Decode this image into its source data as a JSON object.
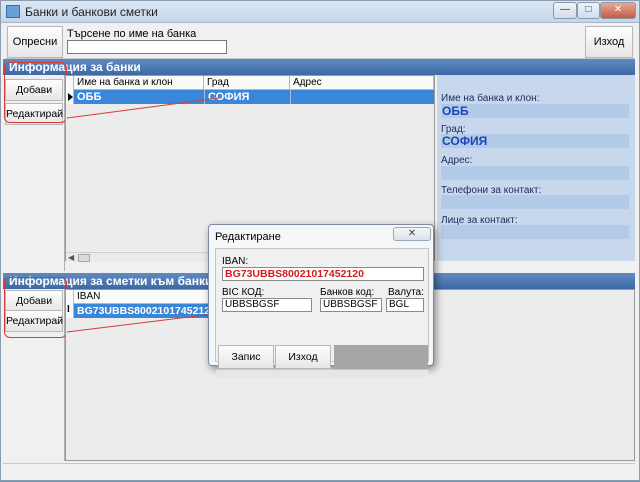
{
  "window": {
    "title": "Банки и банкови сметки"
  },
  "toolbar": {
    "refresh_label": "Опресни",
    "search_label": "Търсене по име на банка",
    "search_value": "",
    "exit_label": "Изход"
  },
  "banks_section": {
    "header": "Информация за банки",
    "add_label": "Добави",
    "edit_label": "Редактирай",
    "columns": [
      "Име на банка и клон",
      "Град",
      "Адрес"
    ],
    "row": {
      "name": "ОББ",
      "city": "СОФИЯ",
      "address": ""
    }
  },
  "bank_details": {
    "name_label": "Име на банка и клон:",
    "name_value": "ОББ",
    "city_label": "Град:",
    "city_value": "СОФИЯ",
    "address_label": "Адрес:",
    "address_value": "",
    "phones_label": "Телефони за контакт:",
    "phones_value": "",
    "contact_label": "Лице за контакт:",
    "contact_value": ""
  },
  "accounts_section": {
    "header": "Информация за сметки към банки",
    "add_label": "Добави",
    "edit_label": "Редактирай",
    "columns": [
      "IBAN"
    ],
    "row": {
      "iban": "BG73UBBS80021017452120"
    }
  },
  "edit_dialog": {
    "title": "Редактиране",
    "iban_label": "IBAN:",
    "iban_value": "BG73UBBS80021017452120",
    "bic_label": "BIC КОД:",
    "bic_value": "UBBSBGSF",
    "bank_code_label": "Банков код:",
    "bank_code_value": "UBBSBGSF",
    "currency_label": "Валута:",
    "currency_value": "BGL",
    "save_label": "Запис",
    "exit_label": "Изход"
  },
  "colors": {
    "section_header": "#3d69a6",
    "selected_row": "#3a86d9",
    "info_panel": "#c7d8ec",
    "iban_text": "#d31b1b",
    "annotation": "#d23c3c"
  }
}
